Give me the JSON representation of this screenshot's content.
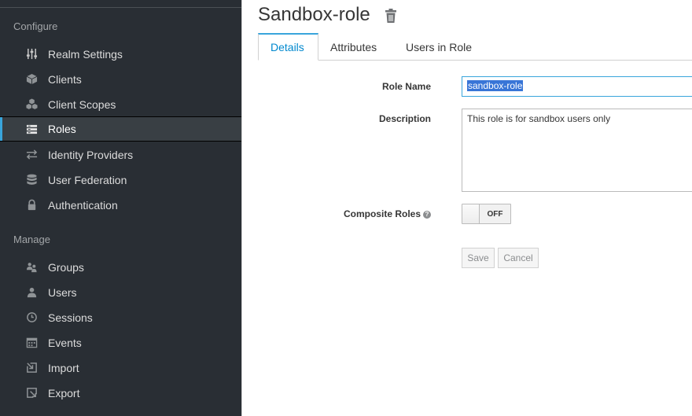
{
  "sidebar": {
    "configure_label": "Configure",
    "manage_label": "Manage",
    "configure_items": [
      {
        "label": "Realm Settings",
        "icon": "sliders-icon"
      },
      {
        "label": "Clients",
        "icon": "cube-icon"
      },
      {
        "label": "Client Scopes",
        "icon": "cubes-icon"
      },
      {
        "label": "Roles",
        "icon": "list-icon",
        "active": true
      },
      {
        "label": "Identity Providers",
        "icon": "exchange-icon"
      },
      {
        "label": "User Federation",
        "icon": "database-icon"
      },
      {
        "label": "Authentication",
        "icon": "lock-icon"
      }
    ],
    "manage_items": [
      {
        "label": "Groups",
        "icon": "users-icon"
      },
      {
        "label": "Users",
        "icon": "user-icon"
      },
      {
        "label": "Sessions",
        "icon": "clock-icon"
      },
      {
        "label": "Events",
        "icon": "calendar-icon"
      },
      {
        "label": "Import",
        "icon": "import-icon"
      },
      {
        "label": "Export",
        "icon": "export-icon"
      }
    ]
  },
  "page": {
    "title": "Sandbox-role",
    "tabs": [
      {
        "label": "Details",
        "active": true
      },
      {
        "label": "Attributes"
      },
      {
        "label": "Users in Role"
      }
    ],
    "form": {
      "role_name_label": "Role Name",
      "role_name_value": "sandbox-role",
      "description_label": "Description",
      "description_value": "This role is for sandbox users only",
      "composite_label": "Composite Roles",
      "composite_state": "OFF",
      "help_glyph": "?"
    },
    "buttons": {
      "save": "Save",
      "cancel": "Cancel"
    }
  },
  "colors": {
    "sidebar_bg": "#292e34",
    "active_accent": "#39a5dc",
    "link_blue": "#0088ce"
  }
}
